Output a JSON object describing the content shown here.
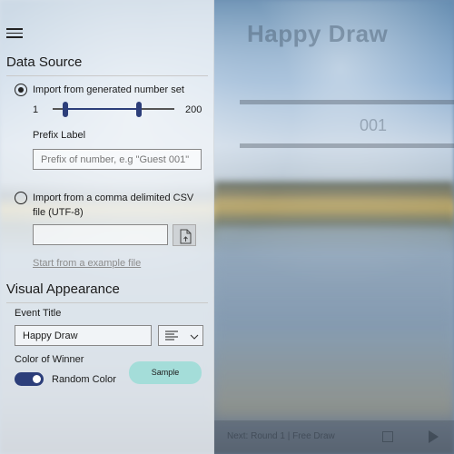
{
  "main": {
    "title": "Happy Draw",
    "number": "001",
    "footer_text": "Next: Round 1 | Free Draw"
  },
  "sidebar": {
    "menu_icon": "hamburger-menu-icon",
    "data_source": {
      "heading": "Data Source",
      "option_generated": {
        "label": "Import from generated number set",
        "selected": true
      },
      "range": {
        "min_label": "1",
        "max_label": "200"
      },
      "prefix": {
        "label": "Prefix Label",
        "placeholder": "Prefix of number, e.g \"Guest 001\"",
        "value": ""
      },
      "option_csv": {
        "label_line1": "Import from a comma delimited CSV",
        "label_line2": "file (UTF-8)",
        "selected": false
      },
      "csv_path": {
        "value": ""
      },
      "file_picker_icon": "file-open-icon",
      "example_link": "Start from a example file"
    },
    "visual": {
      "heading": "Visual Appearance",
      "event_title": {
        "label": "Event Title",
        "value": "Happy Draw"
      },
      "align_icon": "text-align-left-icon",
      "color_of_winner": {
        "label": "Color of Winner",
        "toggle_on": true,
        "toggle_label": "Random Color",
        "sample_button": "Sample",
        "sample_color": "#a4ddd9"
      }
    }
  },
  "colors": {
    "accent": "#2c3e7a"
  }
}
